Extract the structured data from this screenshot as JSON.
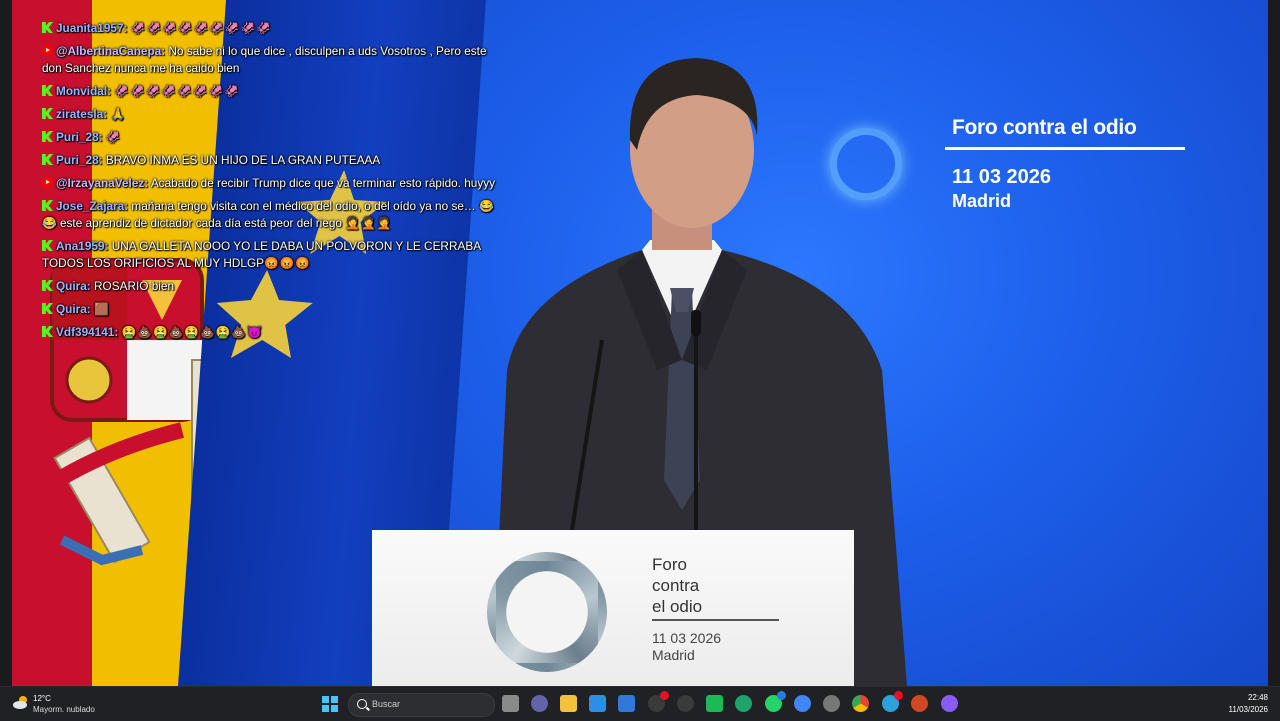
{
  "video": {
    "forum_title": "Foro contra el  odio",
    "forum_date": "11 03 2026",
    "forum_city": "Madrid",
    "lectern_title": "Foro\ncontra\nel  odio",
    "lectern_date": "11 03 2026",
    "lectern_city": "Madrid"
  },
  "chat": [
    {
      "badge": "kick",
      "user": "Juanita1957:",
      "text": "",
      "emotes": "🦑🦑🦑🦑🦑🦑🦑🦑🦑"
    },
    {
      "badge": "youtube",
      "user": "@AlbertinaCanepa:",
      "text": "No sabe ni lo que dice , disculpen a uds Vosotros , Pero este don Sanchez nunca me ha caido bien",
      "emotes": ""
    },
    {
      "badge": "kick",
      "user": "Monvidal:",
      "text": "",
      "emotes": "🦑🦑🦑🦑🦑🦑🦑🦑"
    },
    {
      "badge": "kick",
      "user": "ziratesla:",
      "text": "",
      "emotes": "🙏"
    },
    {
      "badge": "kick",
      "user": "Puri_28:",
      "text": "",
      "emotes": "🦑"
    },
    {
      "badge": "kick",
      "user": "Puri_28:",
      "text": "BRAVO INMA ES UN HIJO DE LA GRAN PUTEAAA",
      "emotes": ""
    },
    {
      "badge": "youtube",
      "user": "@IrzayanaVelez:",
      "text": "Acabado de recibir Trump dice que va terminar esto rápido. huyyy",
      "emotes": ""
    },
    {
      "badge": "kick",
      "user": "Jose_Zajara:",
      "text": "mañana tengo visita con el médico del odio, o del oído ya no se… 😂😂 este aprendiz de dictador cada día está peor del riego",
      "emotes": "🤦🤦🤦"
    },
    {
      "badge": "kick",
      "user": "Ana1959:",
      "text": "UNA GALLETA NOOO YO LE DABA UN POLVORON Y LE CERRABA TODOS LOS ORIFICIOS AL MUY HDLGP",
      "emotes": "😡😡😡"
    },
    {
      "badge": "kick",
      "user": "Quira:",
      "text": "ROSARIO bien",
      "emotes": ""
    },
    {
      "badge": "kick",
      "user": "Quira:",
      "text": "",
      "emotes": "🟫"
    },
    {
      "badge": "kick",
      "user": "Vdf394141:",
      "text": "",
      "emotes": "🤮💩🤮💩🤮💩🤮💩😈"
    }
  ],
  "taskbar": {
    "weather_temp": "12°C",
    "weather_desc": "Mayorm. nublado",
    "search_placeholder": "Buscar",
    "apps": [
      {
        "name": "task-view",
        "color": "#8a8a8a"
      },
      {
        "name": "teams",
        "color": "#6264a7"
      },
      {
        "name": "file-explorer",
        "color": "#f3c13a"
      },
      {
        "name": "store",
        "color": "#2b8fe8"
      },
      {
        "name": "mail",
        "color": "#2f7ad9"
      },
      {
        "name": "chat-app",
        "color": "#e81123"
      },
      {
        "name": "obs",
        "color": "#3a3a3a"
      },
      {
        "name": "app-green",
        "color": "#1db954"
      },
      {
        "name": "edge",
        "color": "#1fa36b"
      },
      {
        "name": "whatsapp",
        "color": "#25d366"
      },
      {
        "name": "chrome-alt",
        "color": "#4285f4"
      },
      {
        "name": "settings",
        "color": "#777"
      },
      {
        "name": "chrome",
        "color": "#ea4335"
      },
      {
        "name": "telegram",
        "color": "#2aa3dc"
      },
      {
        "name": "powerpoint",
        "color": "#d24726"
      },
      {
        "name": "app-purple",
        "color": "#8a5cf6"
      }
    ],
    "time": "22:48",
    "date": "11/03/2026"
  }
}
